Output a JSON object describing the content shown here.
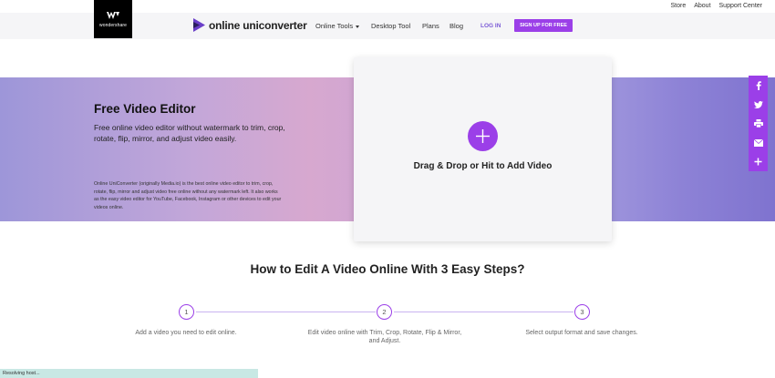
{
  "util_links": [
    "Store",
    "About",
    "Support Center"
  ],
  "wondershare": {
    "logo_text": "wondershare"
  },
  "brand": {
    "name": "online uniconverter",
    "accent": "#6a3fc8"
  },
  "nav": {
    "items": [
      "Online Tools",
      "Desktop Tool",
      "Plans",
      "Blog"
    ],
    "login": "LOG IN",
    "signup": "SIGN UP FOR FREE"
  },
  "hero": {
    "title": "Free Video Editor",
    "subtitle": "Free online video editor without watermark to trim, crop, rotate, flip, mirror, and adjust video easily.",
    "description": "Online UniConverter (originally Media.io) is the best online video editor to trim, crop, rotate, flip, mirror and adjust video free online without any watermark left. It also works as the easy video editor for YouTube, Facebook, Instagram or other devices to edit your videos online."
  },
  "upload": {
    "label": "Drag & Drop or Hit to Add Video",
    "icon": "plus-icon"
  },
  "share": {
    "icons": [
      "facebook-icon",
      "twitter-icon",
      "print-icon",
      "email-icon",
      "more-share-icon"
    ],
    "color": "#9b3fe8"
  },
  "steps": {
    "title": "How to Edit A Video Online With 3 Easy Steps?",
    "items": [
      {
        "number": "1",
        "text": "Add a video you need to edit online."
      },
      {
        "number": "2",
        "text": "Edit video online with Trim, Crop, Rotate, Flip & Mirror, and Adjust."
      },
      {
        "number": "3",
        "text": "Select output format and save changes."
      }
    ]
  },
  "status": {
    "text": "Resolving host..."
  },
  "colors": {
    "primary": "#9b3fe8",
    "login": "#7b5bd6"
  }
}
